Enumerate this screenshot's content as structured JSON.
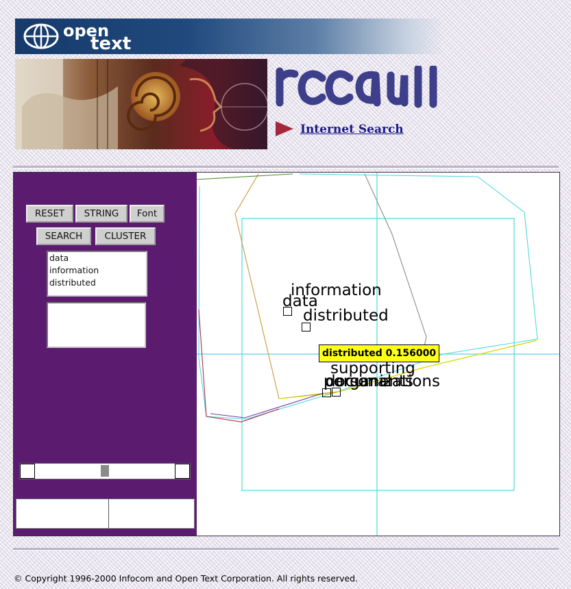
{
  "header": {
    "logo_open": "open",
    "logo_text": "text",
    "search_link": "Internet Search"
  },
  "panel": {
    "buttons": {
      "reset": "RESET",
      "string": "STRING",
      "font": "Font",
      "search": "SEARCH",
      "cluster": "CLUSTER"
    },
    "keywords": [
      "data",
      "information",
      "distributed"
    ],
    "slider_position": 0.5
  },
  "map": {
    "terms": {
      "information": "information",
      "data": "data",
      "distributed": "distributed",
      "supporting": "supporting",
      "personal": "personal",
      "documents": "documents",
      "organizations": "organizations"
    },
    "tooltip": "distributed 0.156000",
    "colors": {
      "crosshair": "#4dd9de",
      "cluster_outline": "#4dd9de",
      "yellow_trace": "#d8d800",
      "orange_trace": "#c89a3a",
      "gray_trace": "#888888",
      "red_trace": "#b03048",
      "purple_trace": "#6a3aa0",
      "tooltip_bg": "#ffff1c"
    }
  },
  "footer": {
    "copyright": "© Copyright 1996-2000 Infocom and Open Text Corporation. All rights reserved."
  }
}
